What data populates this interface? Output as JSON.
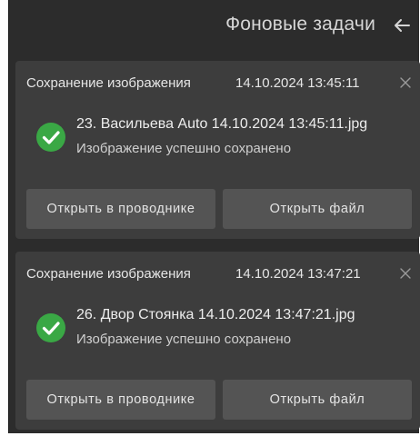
{
  "header": {
    "title": "Фоновые задачи",
    "back_icon": "arrow-left-icon"
  },
  "colors": {
    "panel_bg": "#2c2c2c",
    "card_bg": "#3d3d3d",
    "button_bg": "#545454",
    "success": "#3aa845"
  },
  "tasks": [
    {
      "title": "Сохранение изображения",
      "time": "14.10.2024 13:45:11",
      "file": "23. Васильева Auto 14.10.2024 13:45:11.jpg",
      "status": "Изображение успешно сохранено",
      "status_icon": "check-circle-icon",
      "btn_explorer": "Открыть в проводнике",
      "btn_open": "Открыть файл"
    },
    {
      "title": "Сохранение изображения",
      "time": "14.10.2024 13:47:21",
      "file": "26. Двор Стоянка 14.10.2024 13:47:21.jpg",
      "status": "Изображение успешно сохранено",
      "status_icon": "check-circle-icon",
      "btn_explorer": "Открыть в проводнике",
      "btn_open": "Открыть файл"
    }
  ]
}
